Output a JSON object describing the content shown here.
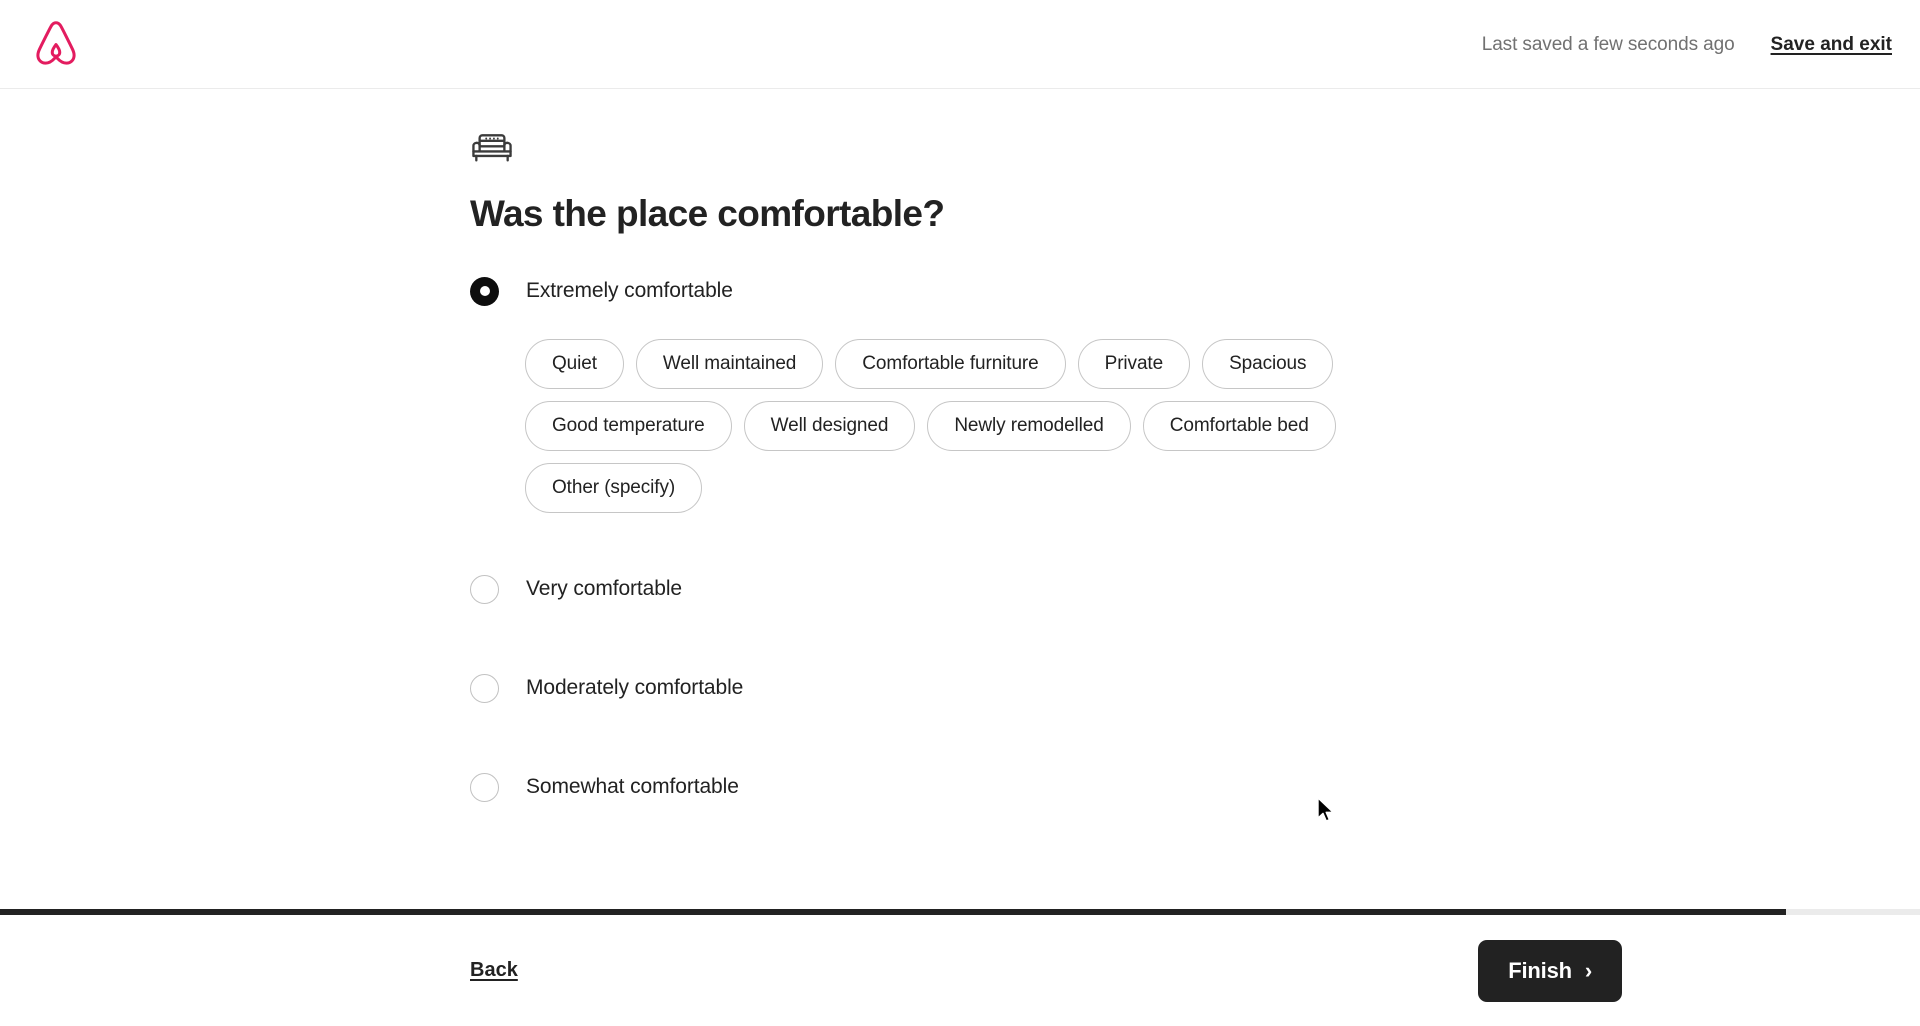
{
  "header": {
    "logo_icon": "airbnb-belo-logo",
    "logo_color": "#e31c5f",
    "last_saved": "Last saved a few seconds ago",
    "save_and_exit": "Save and exit"
  },
  "main": {
    "section_icon": "sofa-icon",
    "title": "Was the place comfortable?",
    "options": [
      {
        "label": "Extremely comfortable",
        "selected": true
      },
      {
        "label": "Very comfortable",
        "selected": false
      },
      {
        "label": "Moderately comfortable",
        "selected": false
      },
      {
        "label": "Somewhat comfortable",
        "selected": false
      }
    ],
    "chips": [
      "Quiet",
      "Well maintained",
      "Comfortable furniture",
      "Private",
      "Spacious",
      "Good temperature",
      "Well designed",
      "Newly remodelled",
      "Comfortable bed",
      "Other (specify)"
    ]
  },
  "footer": {
    "progress_percent": 93,
    "progress_fill_color": "#222222",
    "back_label": "Back",
    "finish_label": "Finish",
    "finish_chevron": "chevron-right-icon"
  }
}
